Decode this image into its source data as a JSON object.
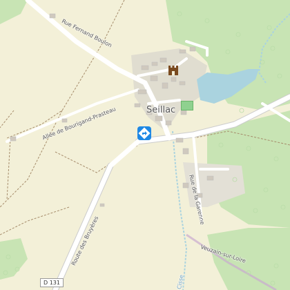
{
  "map": {
    "town_label": "Seillac",
    "road_labels": {
      "rue_fernand_boulon": "Rue Fernand Boulon",
      "allee_bourigand": "Allée de Bourigand-Prasteau",
      "rue_garenne": "Rue de la Garenne",
      "route_bruyeres": "Route des Bruyères",
      "veuzain": "Veuzain-sur-Loire",
      "cisse": "Cisse"
    },
    "route_shield": "D 131",
    "icons": {
      "directions": "directions-icon",
      "castle": "castle-icon",
      "sports_pitch": "sports-pitch-icon"
    },
    "colors": {
      "background": "#f3f0d8",
      "forest": "#c8e4b4",
      "water": "#aad3df",
      "road": "#ffffff",
      "marker": "#1e88e5",
      "boundary": "#c9a9d0"
    }
  }
}
